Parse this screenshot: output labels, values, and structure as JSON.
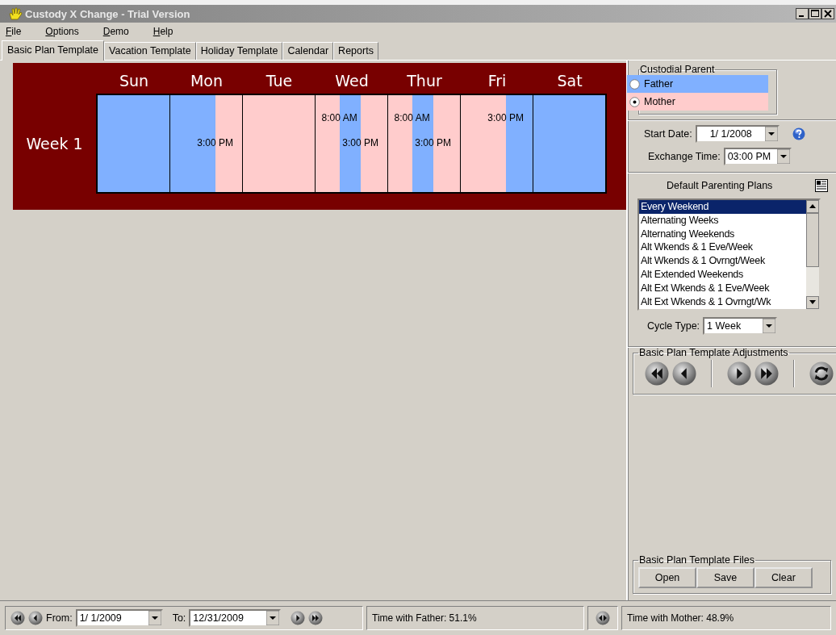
{
  "window": {
    "title": "Custody X Change - Trial Version"
  },
  "menu": [
    {
      "label": "File"
    },
    {
      "label": "Options"
    },
    {
      "label": "Demo"
    },
    {
      "label": "Help"
    }
  ],
  "tabs": [
    {
      "label": "Basic Plan Template",
      "selected": true
    },
    {
      "label": "Vacation Template",
      "selected": false
    },
    {
      "label": "Holiday Template",
      "selected": false
    },
    {
      "label": "Calendar",
      "selected": false
    },
    {
      "label": "Reports",
      "selected": false
    }
  ],
  "calendar": {
    "week_label": "Week 1",
    "days": [
      {
        "name": "Sun",
        "segments": [
          {
            "kind": "father"
          }
        ]
      },
      {
        "name": "Mon",
        "segments": [
          {
            "kind": "father",
            "end_label": {
              "text": "3:00 PM",
              "kind": "middle"
            }
          },
          {
            "kind": "mother"
          }
        ]
      },
      {
        "name": "Tue",
        "segments": [
          {
            "kind": "mother"
          }
        ]
      },
      {
        "name": "Wed",
        "segments": [
          {
            "kind": "mother",
            "end_label": {
              "text": "8:00 AM",
              "kind": "top"
            }
          },
          {
            "kind": "father",
            "end_label": {
              "text": "3:00 PM",
              "kind": "middle"
            }
          },
          {
            "kind": "mother"
          }
        ]
      },
      {
        "name": "Thur",
        "segments": [
          {
            "kind": "mother",
            "end_label": {
              "text": "8:00 AM",
              "kind": "top"
            }
          },
          {
            "kind": "father",
            "end_label": {
              "text": "3:00 PM",
              "kind": "middle"
            }
          },
          {
            "kind": "mother"
          }
        ]
      },
      {
        "name": "Fri",
        "segments": [
          {
            "kind": "mother",
            "end_label": {
              "text": "3:00 PM",
              "kind": "top"
            }
          },
          {
            "kind": "father"
          }
        ]
      },
      {
        "name": "Sat",
        "segments": [
          {
            "kind": "father"
          }
        ]
      }
    ]
  },
  "custodial_parent": {
    "title": "Custodial Parent",
    "options": [
      {
        "label": "Father",
        "kind": "father",
        "selected": false
      },
      {
        "label": "Mother",
        "kind": "mother",
        "selected": true
      }
    ]
  },
  "start_date": {
    "label": "Start Date:",
    "value": "1/ 1/2008"
  },
  "exchange_time": {
    "label": "Exchange Time:",
    "value": "03:00 PM"
  },
  "plans": {
    "title": "Default Parenting Plans",
    "items": [
      {
        "label": "Every Weekend",
        "selected": true
      },
      {
        "label": "Alternating Weeks",
        "selected": false
      },
      {
        "label": "Alternating Weekends",
        "selected": false
      },
      {
        "label": "Alt Wkends & 1 Eve/Week",
        "selected": false
      },
      {
        "label": "Alt Wkends & 1 Ovrngt/Week",
        "selected": false
      },
      {
        "label": "Alt Extended Weekends",
        "selected": false
      },
      {
        "label": "Alt Ext Wkends & 1 Eve/Week",
        "selected": false
      },
      {
        "label": "Alt Ext Wkends & 1 Ovrngt/Wk",
        "selected": false
      }
    ]
  },
  "cycle_type": {
    "label": "Cycle Type:",
    "value": "1 Week"
  },
  "adjustments": {
    "title": "Basic Plan Template Adjustments"
  },
  "files": {
    "title": "Basic Plan Template Files",
    "buttons": [
      "Open",
      "Save",
      "Clear"
    ]
  },
  "status_bar": {
    "from": {
      "label": "From:",
      "value": "1/ 1/2009"
    },
    "to": {
      "label": "To:",
      "value": "12/31/2009"
    },
    "father_time": "Time with Father: 51.1%",
    "mother_time": "Time with Mother: 48.9%"
  }
}
